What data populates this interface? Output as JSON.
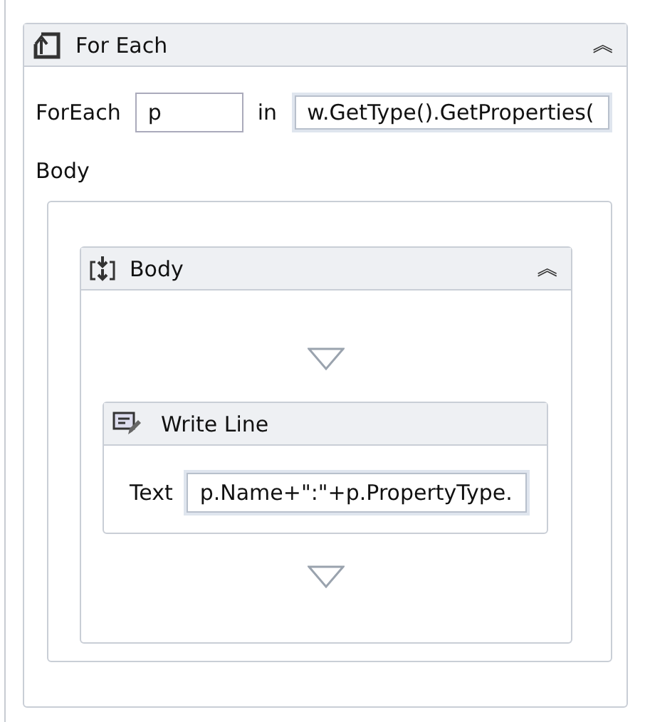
{
  "activity": {
    "title": "For Each",
    "collapse": "︽",
    "foreach": {
      "label": "ForEach",
      "variable": "p",
      "in_label": "in",
      "expression": "w.GetType().GetProperties("
    },
    "body_label": "Body",
    "body": {
      "title": "Body",
      "collapse": "︽",
      "child": {
        "title": "Write Line",
        "text_label": "Text",
        "text_value": "p.Name+\":\"+p.PropertyType."
      }
    }
  }
}
